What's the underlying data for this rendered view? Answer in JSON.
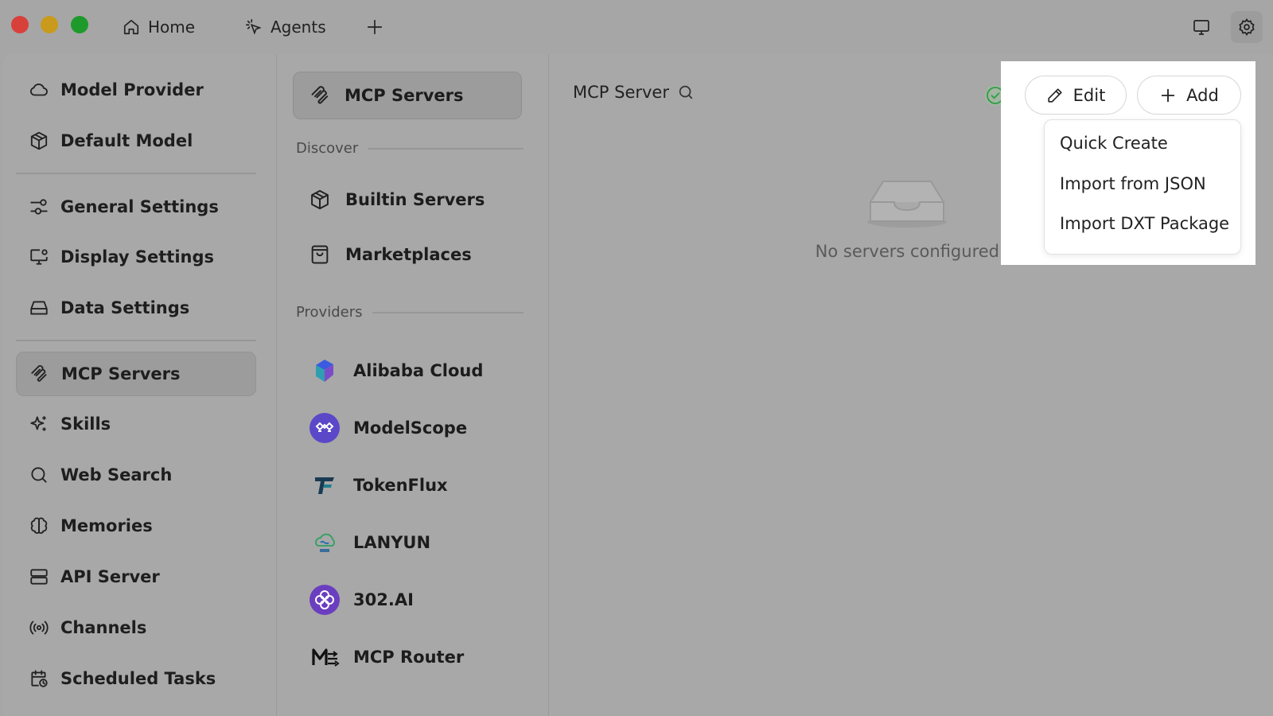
{
  "titlebar": {
    "tabs": [
      {
        "label": "Home",
        "icon": "home-icon"
      },
      {
        "label": "Agents",
        "icon": "agents-icon"
      }
    ],
    "add_tab_icon": "plus-icon",
    "right_icons": [
      "monitor-icon",
      "gear-icon"
    ]
  },
  "sidebar": {
    "items": [
      {
        "label": "Model Provider",
        "icon": "cloud-icon"
      },
      {
        "label": "Default Model",
        "icon": "cube-icon"
      },
      {
        "label": "General Settings",
        "icon": "sliders-icon"
      },
      {
        "label": "Display Settings",
        "icon": "display-settings-icon"
      },
      {
        "label": "Data Settings",
        "icon": "hard-drive-icon"
      },
      {
        "label": "MCP Servers",
        "icon": "mcp-icon",
        "active": true
      },
      {
        "label": "Skills",
        "icon": "sparkle-icon"
      },
      {
        "label": "Web Search",
        "icon": "search-icon"
      },
      {
        "label": "Memories",
        "icon": "brain-icon"
      },
      {
        "label": "API Server",
        "icon": "server-icon"
      },
      {
        "label": "Channels",
        "icon": "broadcast-icon"
      },
      {
        "label": "Scheduled Tasks",
        "icon": "calendar-clock-icon"
      }
    ]
  },
  "mcp_nav": {
    "active_label": "MCP Servers",
    "discover_label": "Discover",
    "discover_items": [
      {
        "label": "Builtin Servers",
        "icon": "cube-icon"
      },
      {
        "label": "Marketplaces",
        "icon": "shopping-bag-icon"
      }
    ],
    "providers_label": "Providers",
    "providers": [
      {
        "label": "Alibaba Cloud",
        "icon": "alibaba-cloud-logo"
      },
      {
        "label": "ModelScope",
        "icon": "modelscope-logo"
      },
      {
        "label": "TokenFlux",
        "icon": "tokenflux-logo"
      },
      {
        "label": "LANYUN",
        "icon": "lanyun-logo"
      },
      {
        "label": "302.AI",
        "icon": "302ai-logo"
      },
      {
        "label": "MCP Router",
        "icon": "mcp-router-logo"
      }
    ]
  },
  "main": {
    "title": "MCP Server",
    "empty_text": "No servers configured",
    "edit_label": "Edit",
    "add_label": "Add",
    "add_menu": [
      "Quick Create",
      "Import from JSON",
      "Import DXT Package"
    ]
  },
  "colors": {
    "background": "#a6a6a6",
    "status_green": "#2f9e44",
    "popup_background": "#ffffff"
  }
}
